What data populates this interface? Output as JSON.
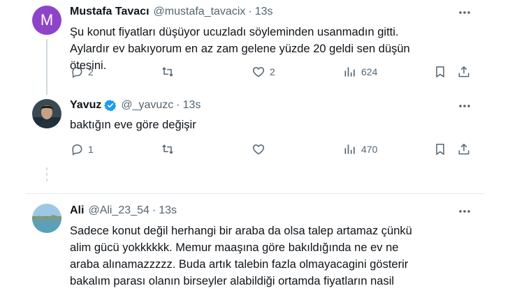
{
  "tweets": [
    {
      "name": "Mustafa Tavacı",
      "handle": "@mustafa_tavacix",
      "time": "13s",
      "avatar_letter": "M",
      "text": "Şu konut fiyatları düşüyor ucuzladı söyleminden usanmadın gitti. Aylardır ev bakıyorum en az zam gelene yüzde 20 geldi sen düşün ötesini.",
      "replies": "2",
      "likes": "2",
      "views": "624"
    },
    {
      "name": "Yavuz",
      "handle": "@_yavuzc",
      "time": "13s",
      "verified": true,
      "text": "baktığın eve göre değişir",
      "replies": "1",
      "views": "470"
    },
    {
      "name": "Ali",
      "handle": "@Ali_23_54",
      "time": "13s",
      "text": "Sadece konut değil herhangi bir araba da olsa talep artamaz çünkü alim gücü yokkkkkk. Memur maaşına göre bakıldığında ne ev ne araba alınamazzzzz. Buda artık talebin fazla olmayacagini gösterir bakalım parası olanın birseyler alabildiği ortamda fiyatların nasil olacağını görecz"
    }
  ],
  "colors": {
    "text": "#0f1419",
    "secondary": "#536471",
    "verified": "#1d9bf0",
    "avatar_m": "#8e44c8",
    "divider": "#e6ecf0"
  }
}
